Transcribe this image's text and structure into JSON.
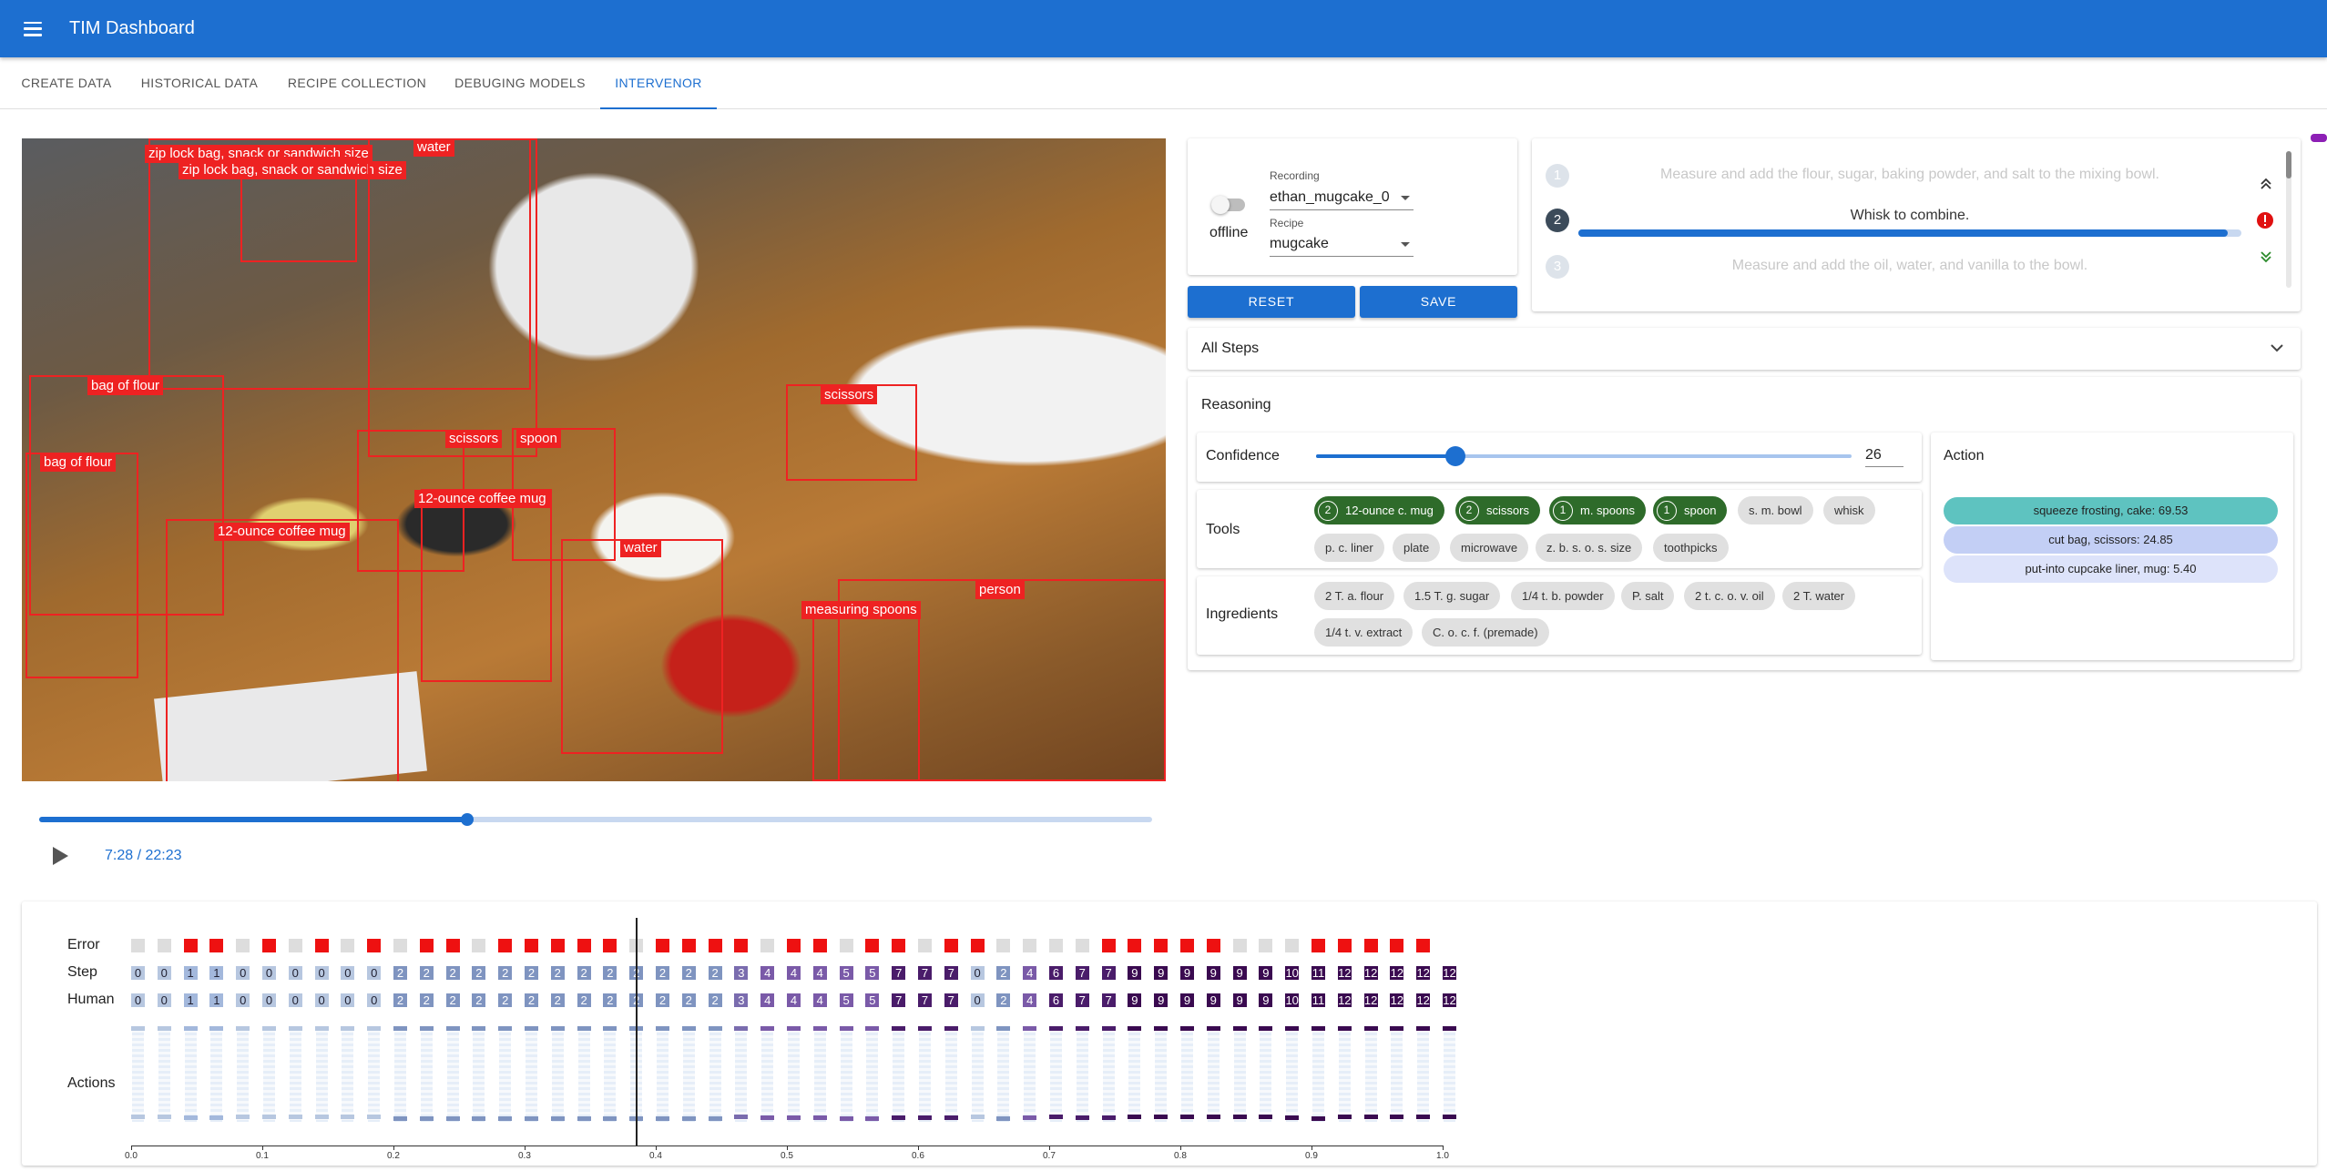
{
  "appbar": {
    "title": "TIM Dashboard",
    "menu_icon": "menu-icon"
  },
  "tabs": [
    "CREATE DATA",
    "HISTORICAL DATA",
    "RECIPE COLLECTION",
    "DEBUGING MODELS",
    "INTERVENOR"
  ],
  "active_tab": "INTERVENOR",
  "video": {
    "detections": [
      "zip lock bag, snack or sandwich size",
      "zip lock bag, snack or sandwich size",
      "water",
      "bag of flour",
      "bag of flour",
      "12-ounce coffee mug",
      "scissors",
      "spoon",
      "12-ounce coffee mug",
      "water",
      "scissors",
      "measuring spoons",
      "person"
    ]
  },
  "player": {
    "time": "7:28 / 22:23",
    "progress_fraction": 0.385,
    "play_icon": "play-icon"
  },
  "controls": {
    "offline_label": "offline",
    "recording_label": "Recording",
    "recording_value": "ethan_mugcake_0",
    "recipe_label": "Recipe",
    "recipe_value": "mugcake",
    "reset_label": "RESET",
    "save_label": "SAVE"
  },
  "steps": [
    {
      "num": "1",
      "text": "Measure and add the flour, sugar, baking powder, and salt to the mixing bowl."
    },
    {
      "num": "2",
      "text": "Whisk to combine.",
      "progress": 0.98
    },
    {
      "num": "3",
      "text": "Measure and add the oil, water, and vanilla to the bowl."
    }
  ],
  "all_steps_label": "All Steps",
  "reasoning": {
    "title": "Reasoning",
    "confidence_label": "Confidence",
    "confidence_value": "26",
    "confidence_fraction": 0.26,
    "tools_label": "Tools",
    "tools_active": [
      {
        "count": "2",
        "name": "12-ounce c. mug"
      },
      {
        "count": "2",
        "name": "scissors"
      },
      {
        "count": "1",
        "name": "m. spoons"
      },
      {
        "count": "1",
        "name": "spoon"
      }
    ],
    "tools_inactive": [
      "s. m. bowl",
      "whisk",
      "p. c. liner",
      "plate",
      "microwave",
      "z. b. s. o. s. size",
      "toothpicks"
    ],
    "ingredients_label": "Ingredients",
    "ingredients": [
      "2 T. a. flour",
      "1.5 T. g. sugar",
      "1/4 t. b. powder",
      "P. salt",
      "2 t. c. o. v. oil",
      "2 T. water",
      "1/4 t. v. extract",
      "C. o. c. f. (premade)"
    ],
    "action_label": "Action",
    "actions": [
      {
        "text": "squeeze frosting, cake: 69.53",
        "color": "#5ec3c0"
      },
      {
        "text": "cut bag, scissors: 24.85",
        "color": "#c3cff5"
      },
      {
        "text": "put-into cupcake liner, mug: 5.40",
        "color": "#dde3fa"
      }
    ]
  },
  "timeline_chart": {
    "row_labels": [
      "Error",
      "Step",
      "Human",
      "Actions"
    ],
    "error": [
      0,
      0,
      1,
      1,
      0,
      1,
      0,
      1,
      0,
      1,
      0,
      1,
      1,
      0,
      1,
      1,
      1,
      1,
      1,
      0,
      1,
      1,
      1,
      1,
      0,
      1,
      1,
      0,
      1,
      1,
      0,
      1,
      1,
      0,
      0,
      0,
      0,
      1,
      1,
      1,
      1,
      1,
      0,
      0,
      0,
      1,
      1,
      1,
      1,
      1
    ],
    "step": [
      "0",
      "0",
      "1",
      "1",
      "0",
      "0",
      "0",
      "0",
      "0",
      "0",
      "2",
      "2",
      "2",
      "2",
      "2",
      "2",
      "2",
      "2",
      "2",
      "2",
      "2",
      "2",
      "2",
      "3",
      "4",
      "4",
      "4",
      "5",
      "5",
      "7",
      "7",
      "7",
      "0",
      "2",
      "4",
      "6",
      "7",
      "7",
      "9",
      "9",
      "9",
      "9",
      "9",
      "9",
      "10",
      "11",
      "12",
      "12",
      "12",
      "12",
      "12"
    ],
    "human": [
      "0",
      "0",
      "1",
      "1",
      "0",
      "0",
      "0",
      "0",
      "0",
      "0",
      "2",
      "2",
      "2",
      "2",
      "2",
      "2",
      "2",
      "2",
      "2",
      "2",
      "2",
      "2",
      "2",
      "3",
      "4",
      "4",
      "4",
      "5",
      "5",
      "7",
      "7",
      "7",
      "0",
      "2",
      "4",
      "6",
      "7",
      "7",
      "9",
      "9",
      "9",
      "9",
      "9",
      "9",
      "10",
      "11",
      "12",
      "12",
      "12",
      "12",
      "12"
    ],
    "x_ticks": [
      "0.0",
      "0.1",
      "0.2",
      "0.3",
      "0.4",
      "0.5",
      "0.6",
      "0.7",
      "0.8",
      "0.9",
      "1.0"
    ],
    "cursor_fraction": 0.385,
    "colors": {
      "error": "#ee1111",
      "no_error": "#dddddd",
      "accent": "#1d6fd0"
    }
  }
}
